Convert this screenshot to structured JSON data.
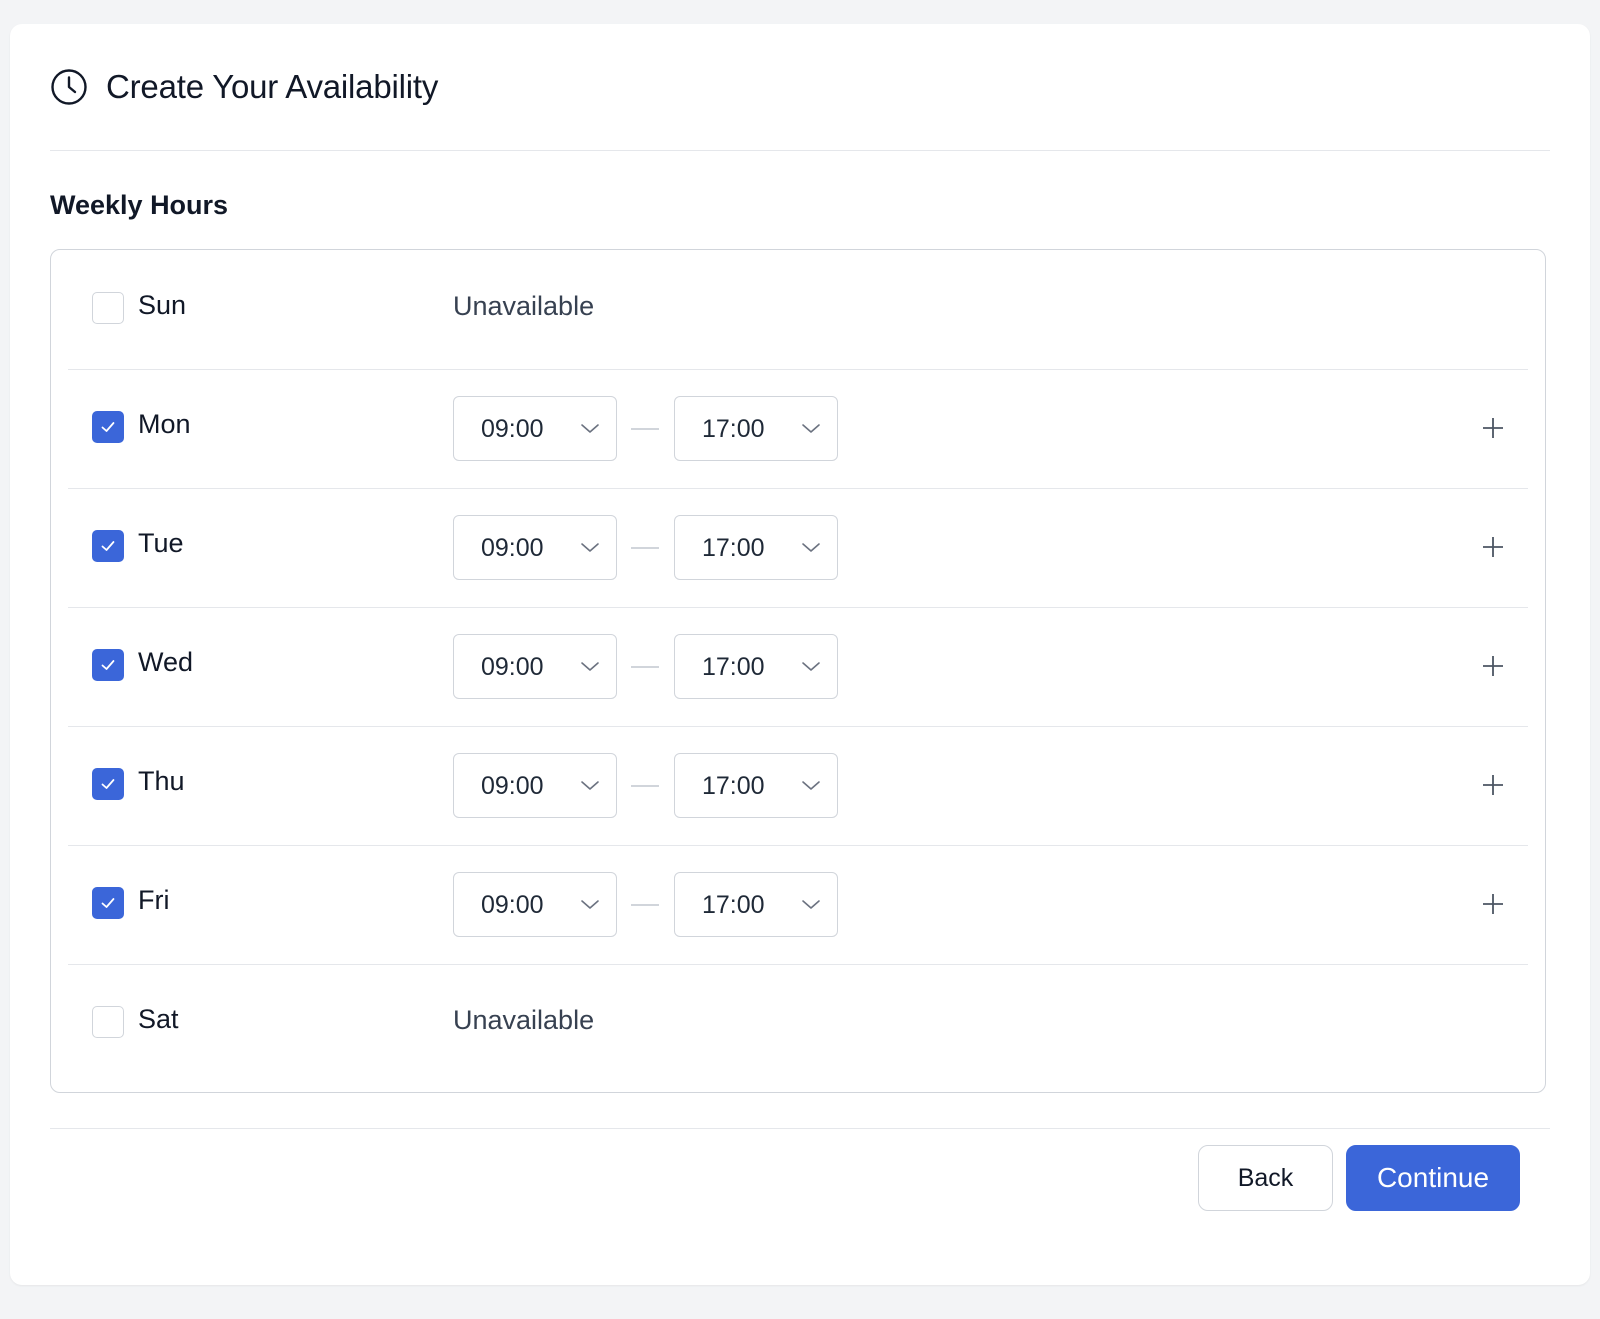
{
  "header": {
    "title": "Create Your Availability",
    "icon": "clock-icon"
  },
  "section": {
    "title": "Weekly Hours"
  },
  "days": [
    {
      "label": "Sun",
      "checked": false,
      "status": "Unavailable"
    },
    {
      "label": "Mon",
      "checked": true,
      "start": "09:00",
      "end": "17:00"
    },
    {
      "label": "Tue",
      "checked": true,
      "start": "09:00",
      "end": "17:00"
    },
    {
      "label": "Wed",
      "checked": true,
      "start": "09:00",
      "end": "17:00"
    },
    {
      "label": "Thu",
      "checked": true,
      "start": "09:00",
      "end": "17:00"
    },
    {
      "label": "Fri",
      "checked": true,
      "start": "09:00",
      "end": "17:00"
    },
    {
      "label": "Sat",
      "checked": false,
      "status": "Unavailable"
    }
  ],
  "footer": {
    "back_label": "Back",
    "continue_label": "Continue"
  },
  "colors": {
    "accent": "#3b66d9",
    "border": "#d1d5db",
    "background": "#f3f4f6"
  }
}
